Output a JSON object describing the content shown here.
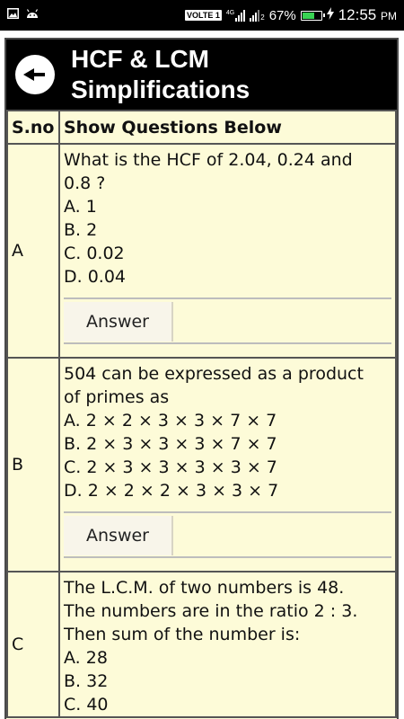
{
  "status_bar": {
    "network_label": "VOLTE 1",
    "sim1_tag": "4G",
    "sim2_tag": "2",
    "battery": "67%",
    "battery_level": 0.67,
    "time": "12:55",
    "ampm": "PM"
  },
  "header": {
    "title_line1": "HCF & LCM",
    "title_line2": "Simplifications"
  },
  "table": {
    "col_sno": "S.no",
    "col_questions": "Show Questions Below",
    "rows": [
      {
        "sno": "A",
        "question_line1": "What is the HCF of 2.04, 0.24 and",
        "question_line2": "0.8 ?",
        "options": [
          "A. 1",
          "B. 2",
          "C. 0.02",
          "D. 0.04"
        ],
        "answer_label": "Answer"
      },
      {
        "sno": "B",
        "question_line1": "504 can be expressed as a product",
        "question_line2": "of primes as",
        "options": [
          "A. 2 × 2 × 3 × 3 × 7 × 7",
          "B. 2 × 3 × 3 × 3 × 7 × 7",
          "C. 2 × 3 × 3 × 3 × 3 × 7",
          "D. 2 × 2 × 2 × 3 × 3 × 7"
        ],
        "answer_label": "Answer"
      },
      {
        "sno": "C",
        "question_line1": "The L.C.M. of two numbers is 48.",
        "question_line2": "The numbers are in the ratio 2 : 3.",
        "question_line3": "Then sum of the number is:",
        "options": [
          "A. 28",
          "B. 32",
          "C. 40"
        ]
      }
    ]
  }
}
